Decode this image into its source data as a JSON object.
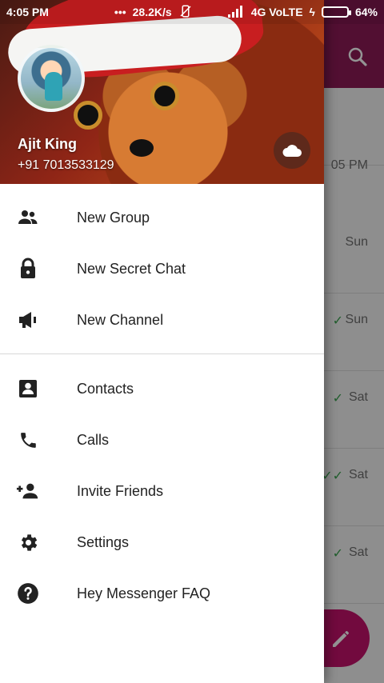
{
  "status_bar": {
    "time": "4:05 PM",
    "network_speed": "28.2K/s",
    "network_type": "4G VoLTE",
    "battery_percent": "64%",
    "battery_level": 0.64
  },
  "profile": {
    "name": "Ajit King",
    "phone": "+91 7013533129"
  },
  "drawer_menu": {
    "group_one": [
      {
        "label": "New Group",
        "icon": "group-icon"
      },
      {
        "label": "New Secret Chat",
        "icon": "lock-icon"
      },
      {
        "label": "New Channel",
        "icon": "megaphone-icon"
      }
    ],
    "group_two": [
      {
        "label": "Contacts",
        "icon": "contacts-icon"
      },
      {
        "label": "Calls",
        "icon": "phone-icon"
      },
      {
        "label": "Invite Friends",
        "icon": "add-person-icon"
      },
      {
        "label": "Settings",
        "icon": "gear-icon"
      },
      {
        "label": "Hey Messenger FAQ",
        "icon": "help-icon"
      }
    ]
  },
  "background_chat_list": [
    {
      "time": "05 PM"
    },
    {
      "time": "Sun"
    },
    {
      "time": "Sun",
      "status": "✓"
    },
    {
      "time": "Sat",
      "status": "✓"
    },
    {
      "time": "Sat",
      "status": "✓✓"
    },
    {
      "time": "Sat",
      "status": "✓"
    }
  ],
  "colors": {
    "app_bar": "#8e1a57",
    "fab": "#c4126b",
    "drawer_background": "#ffffff",
    "text": "#222222"
  }
}
